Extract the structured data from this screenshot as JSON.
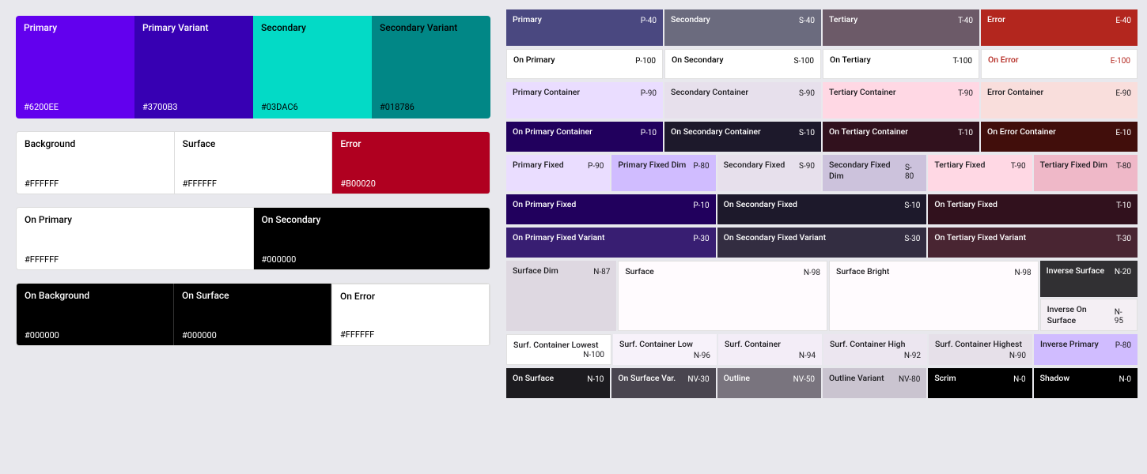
{
  "left": {
    "row1": [
      {
        "label": "Primary",
        "hex": "#6200EE",
        "bg": "#6200EE",
        "textColor": "#ffffff"
      },
      {
        "label": "Primary Variant",
        "hex": "#3700B3",
        "bg": "#3700B3",
        "textColor": "#ffffff"
      },
      {
        "label": "Secondary",
        "hex": "#03DAC6",
        "bg": "#03DAC6",
        "textColor": "#000000"
      },
      {
        "label": "Secondary Variant",
        "hex": "#018786",
        "bg": "#018786",
        "textColor": "#000000"
      }
    ],
    "row2": [
      {
        "label": "Background",
        "hex": "#FFFFFF",
        "bg": "#ffffff",
        "textColor": "#000000"
      },
      {
        "label": "Surface",
        "hex": "#FFFFFF",
        "bg": "#ffffff",
        "textColor": "#000000"
      },
      {
        "label": "Error",
        "hex": "#B00020",
        "bg": "#B00020",
        "textColor": "#ffffff"
      }
    ],
    "row3": [
      {
        "label": "On Primary",
        "hex": "#FFFFFF",
        "bg": "#ffffff",
        "textColor": "#000000"
      },
      {
        "label": "On Secondary",
        "hex": "#000000",
        "bg": "#000000",
        "textColor": "#ffffff"
      }
    ],
    "row4": [
      {
        "label": "On Background",
        "hex": "#000000",
        "bg": "#000000",
        "textColor": "#ffffff"
      },
      {
        "label": "On Surface",
        "hex": "#000000",
        "bg": "#000000",
        "textColor": "#ffffff"
      },
      {
        "label": "On Error",
        "hex": "#FFFFFF",
        "bg": "#ffffff",
        "textColor": "#000000"
      }
    ]
  },
  "right": {
    "row1": [
      {
        "label": "Primary",
        "code": "P-40",
        "bg": "#4a4880",
        "textColor": "#ffffff"
      },
      {
        "label": "Secondary",
        "code": "S-40",
        "bg": "#6b6b7e",
        "textColor": "#ffffff"
      },
      {
        "label": "Tertiary",
        "code": "T-40",
        "bg": "#6c5a68",
        "textColor": "#ffffff"
      },
      {
        "label": "Error",
        "code": "E-40",
        "bg": "#b3261e",
        "textColor": "#ffffff"
      }
    ],
    "row2": [
      {
        "label": "On Primary",
        "code": "P-100",
        "bg": "#ffffff",
        "textColor": "#000000"
      },
      {
        "label": "On Secondary",
        "code": "S-100",
        "bg": "#ffffff",
        "textColor": "#000000"
      },
      {
        "label": "On Tertiary",
        "code": "T-100",
        "bg": "#ffffff",
        "textColor": "#000000"
      },
      {
        "label": "On Error",
        "code": "E-100",
        "bg": "#ffffff",
        "textColor": "#b3261e"
      }
    ],
    "row3": [
      {
        "label": "Primary Container",
        "code": "P-90",
        "bg": "#eaddff",
        "textColor": "#1c1b1f"
      },
      {
        "label": "Secondary Container",
        "code": "S-90",
        "bg": "#e7e0ec",
        "textColor": "#1c1b1f"
      },
      {
        "label": "Tertiary Container",
        "code": "T-90",
        "bg": "#ffd8e4",
        "textColor": "#1c1b1f"
      },
      {
        "label": "Error Container",
        "code": "E-90",
        "bg": "#f9dedc",
        "textColor": "#1c1b1f"
      }
    ],
    "row4": [
      {
        "label": "On Primary Container",
        "code": "P-10",
        "bg": "#21005d",
        "textColor": "#ffffff"
      },
      {
        "label": "On Secondary Container",
        "code": "S-10",
        "bg": "#1d192b",
        "textColor": "#ffffff"
      },
      {
        "label": "On Tertiary Container",
        "code": "T-10",
        "bg": "#31111d",
        "textColor": "#ffffff"
      },
      {
        "label": "On Error Container",
        "code": "E-10",
        "bg": "#410e0b",
        "textColor": "#ffffff"
      }
    ],
    "row5": [
      {
        "label": "Primary Fixed",
        "code": "P-90",
        "bg": "#eaddff",
        "textColor": "#1c1b1f"
      },
      {
        "label": "Primary Fixed Dim",
        "code": "P-80",
        "bg": "#d0bcff",
        "textColor": "#1c1b1f"
      },
      {
        "label": "Secondary Fixed",
        "code": "S-90",
        "bg": "#e7e0ec",
        "textColor": "#1c1b1f"
      },
      {
        "label": "Secondary Fixed Dim",
        "code": "S-80",
        "bg": "#ccc2dc",
        "textColor": "#1c1b1f"
      },
      {
        "label": "Tertiary Fixed",
        "code": "T-90",
        "bg": "#ffd8e4",
        "textColor": "#1c1b1f"
      },
      {
        "label": "Tertiary Fixed Dim",
        "code": "T-80",
        "bg": "#efb8c8",
        "textColor": "#1c1b1f"
      }
    ],
    "row6": [
      {
        "label": "On Primary Fixed",
        "code": "P-10",
        "bg": "#21005d",
        "textColor": "#ffffff"
      },
      {
        "label": "On Secondary Fixed",
        "code": "S-10",
        "bg": "#1d192b",
        "textColor": "#ffffff"
      },
      {
        "label": "On Tertiary Fixed",
        "code": "T-10",
        "bg": "#31111d",
        "textColor": "#ffffff"
      }
    ],
    "row7": [
      {
        "label": "On Primary Fixed Variant",
        "code": "P-30",
        "bg": "#381e72",
        "textColor": "#ffffff"
      },
      {
        "label": "On Secondary Fixed Variant",
        "code": "S-30",
        "bg": "#332d41",
        "textColor": "#ffffff"
      },
      {
        "label": "On Tertiary Fixed Variant",
        "code": "T-30",
        "bg": "#492532",
        "textColor": "#ffffff"
      }
    ],
    "row8": [
      {
        "label": "Surface Dim",
        "code": "N-87",
        "bg": "#ded8e1",
        "textColor": "#1c1b1f"
      },
      {
        "label": "Surface",
        "code": "N-98",
        "bg": "#fffbfe",
        "textColor": "#1c1b1f"
      },
      {
        "label": "Surface Bright",
        "code": "N-98",
        "bg": "#fffbfe",
        "textColor": "#1c1b1f"
      },
      {
        "label": "Inverse Surface",
        "code": "N-20",
        "bg": "#313033",
        "textColor": "#ffffff"
      }
    ],
    "row9": [
      {
        "label": "Surf. Container Lowest",
        "code": "N-100",
        "bg": "#ffffff",
        "textColor": "#1c1b1f"
      },
      {
        "label": "Surf. Container Low",
        "code": "N-96",
        "bg": "#f7f2fa",
        "textColor": "#1c1b1f"
      },
      {
        "label": "Surf. Container",
        "code": "N-94",
        "bg": "#f3edf7",
        "textColor": "#1c1b1f"
      },
      {
        "label": "Surf. Container High",
        "code": "N-92",
        "bg": "#ece6f0",
        "textColor": "#1c1b1f"
      },
      {
        "label": "Surf. Container Highest",
        "code": "N-90",
        "bg": "#e6e0e9",
        "textColor": "#1c1b1f"
      },
      {
        "label": "Inverse On Surface",
        "code": "N-95",
        "bg": "#f4eff4",
        "textColor": "#1c1b1f"
      }
    ],
    "row10": [
      {
        "label": "On Surface",
        "code": "N-10",
        "bg": "#1c1b1f",
        "textColor": "#ffffff"
      },
      {
        "label": "On Surface Var.",
        "code": "NV-30",
        "bg": "#49454f",
        "textColor": "#ffffff"
      },
      {
        "label": "Outline",
        "code": "NV-50",
        "bg": "#79747e",
        "textColor": "#ffffff"
      },
      {
        "label": "Outline Variant",
        "code": "NV-80",
        "bg": "#cac4d0",
        "textColor": "#1c1b1f"
      },
      {
        "label": "Scrim",
        "code": "N-0",
        "bg": "#000000",
        "textColor": "#ffffff"
      },
      {
        "label": "Shadow",
        "code": "N-0",
        "bg": "#000000",
        "textColor": "#ffffff"
      }
    ]
  }
}
